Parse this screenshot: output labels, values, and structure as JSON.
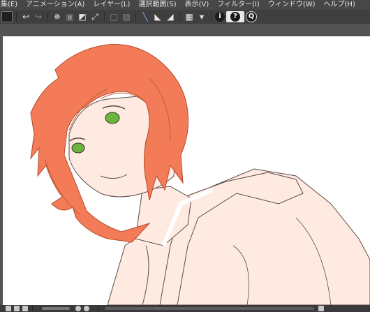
{
  "menu": [
    {
      "label": "集(E)"
    },
    {
      "label": "アニメーション(A)"
    },
    {
      "label": "レイヤー(L)"
    },
    {
      "label": "選択範囲(S)"
    },
    {
      "label": "表示(V)"
    },
    {
      "label": "フィルター(I)"
    },
    {
      "label": "ウィンドウ(W)"
    },
    {
      "label": "ヘルプ(H)"
    }
  ],
  "toolbar": {
    "icons": [
      "square-icon",
      "undo-icon",
      "redo-icon",
      "settings-icon",
      "transform-icon",
      "fill-icon",
      "scale-icon",
      "layer-icon",
      "layer-alt-icon",
      "pen-icon",
      "ruler-icon",
      "ruler-alt-icon",
      "grid-icon",
      "display-icon",
      "info-icon",
      "help-icon",
      "search-icon"
    ],
    "help_label": "?",
    "info_label": "i",
    "search_label": "Q"
  },
  "colors": {
    "hair": "#F47B57",
    "skin": "#FFEAE2",
    "eye": "#6DB33F",
    "line": "#5a4a44",
    "canvas": "#ffffff",
    "background": "#535353"
  }
}
